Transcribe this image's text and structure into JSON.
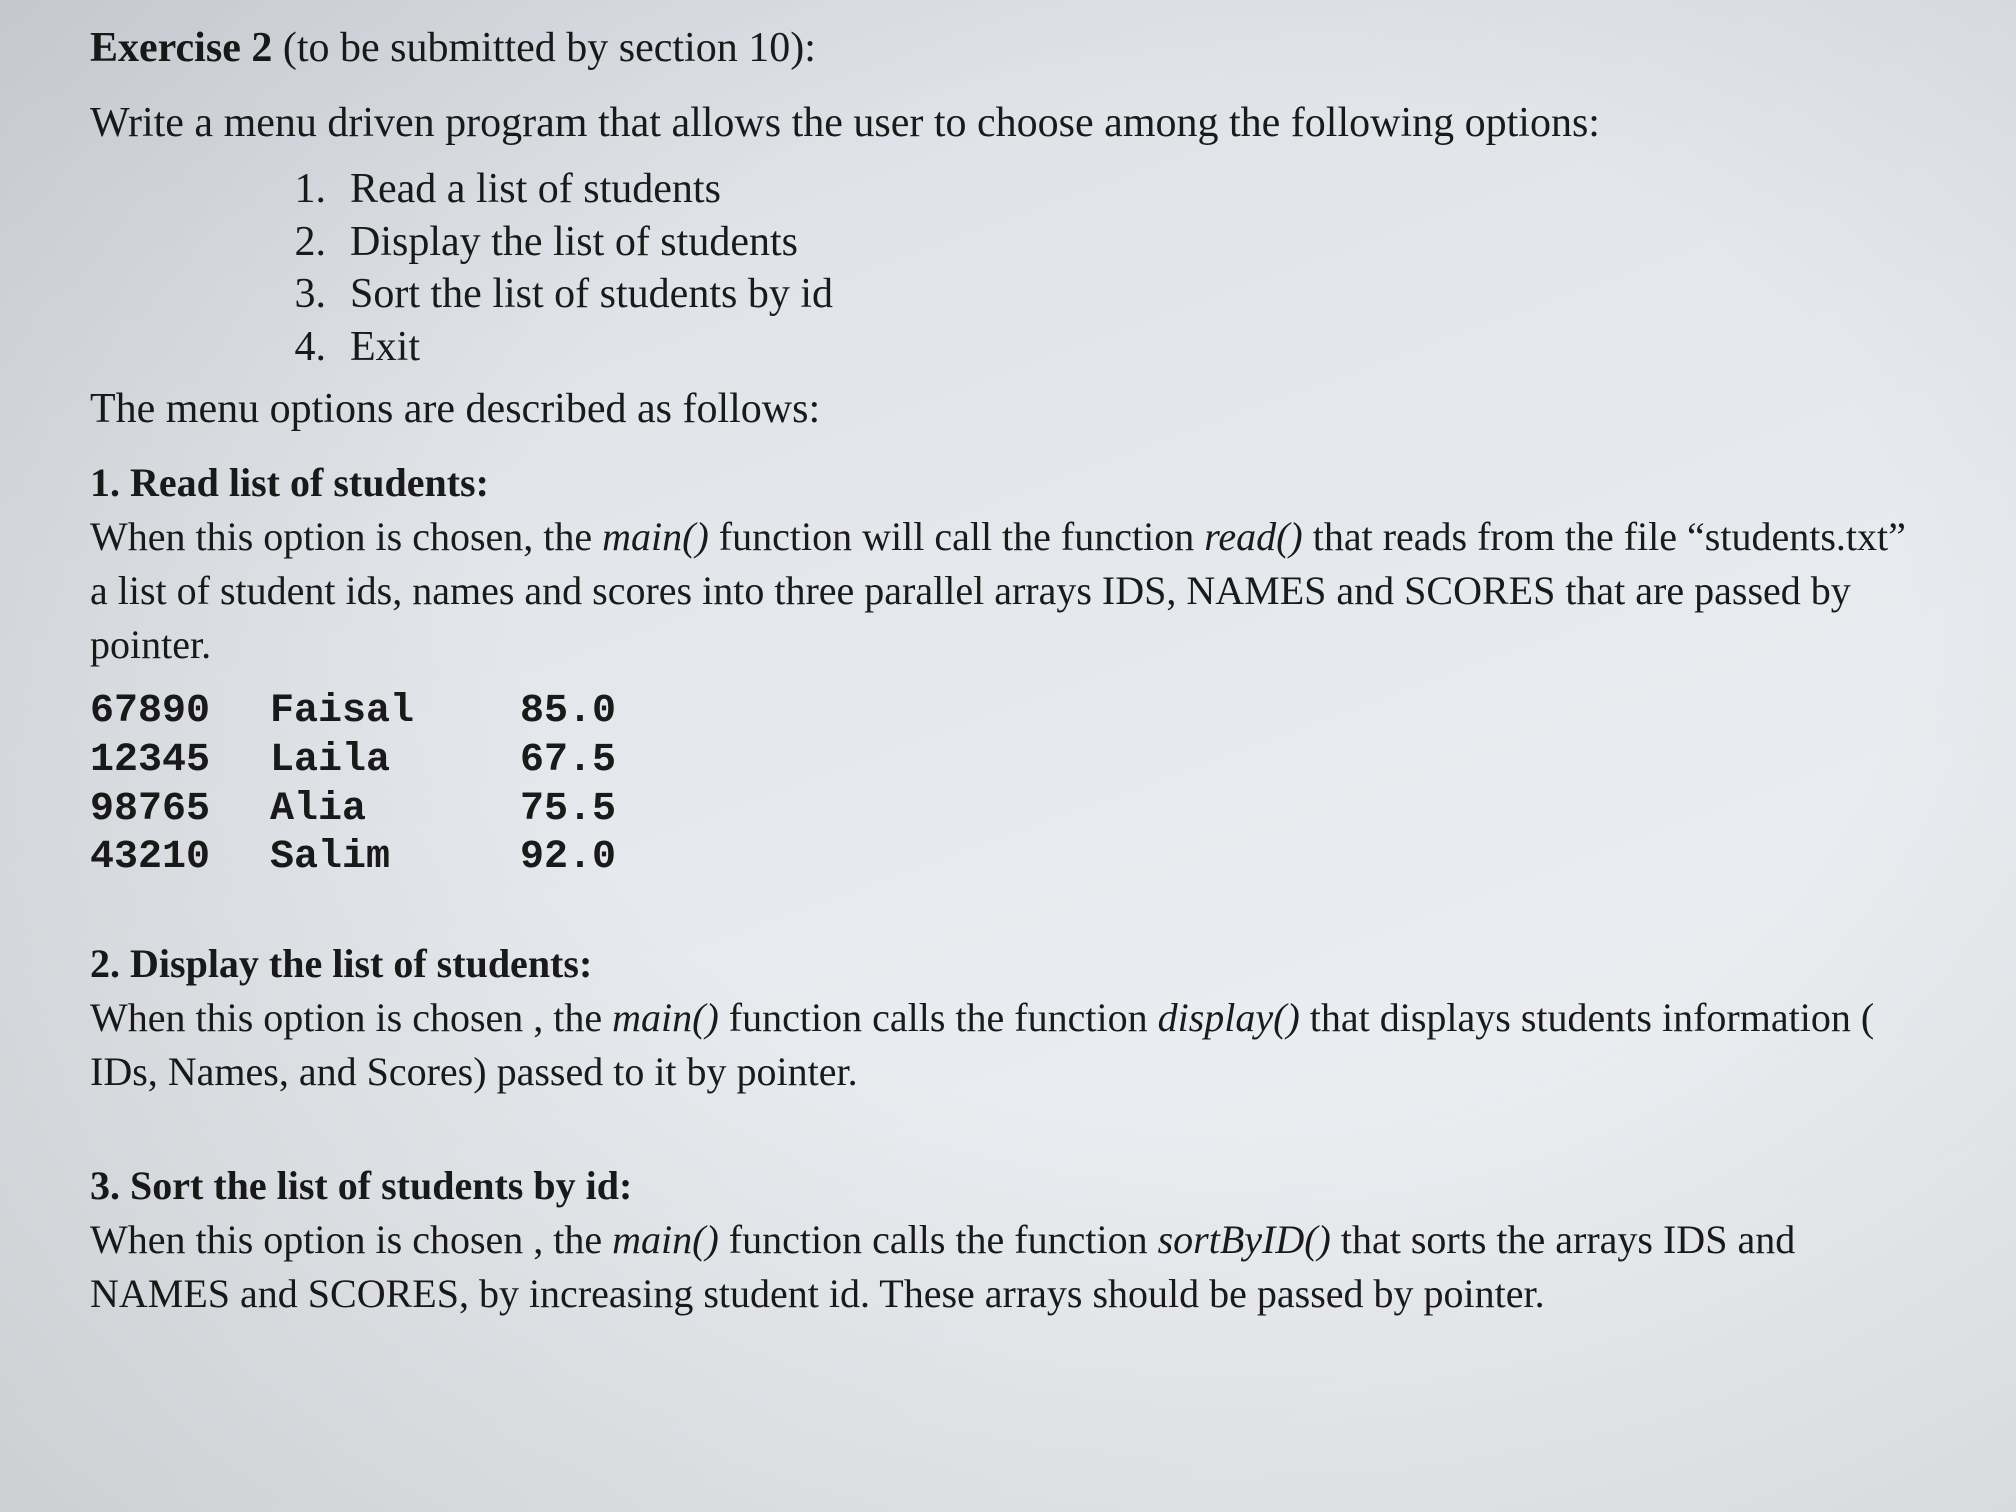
{
  "title": {
    "bold": "Exercise 2",
    "rest": " (to be submitted by section 10):"
  },
  "intro": "Write a  menu driven program that allows the user to choose among the following options:",
  "menu": [
    {
      "num": "1.",
      "label": "Read a list of students"
    },
    {
      "num": "2.",
      "label": "Display the list of students"
    },
    {
      "num": "3.",
      "label": "Sort the list of students by id"
    },
    {
      "num": "4.",
      "label": "Exit"
    }
  ],
  "desc_line": "The menu options are described as follows:",
  "section1": {
    "head": "1. Read list of students:",
    "p1a": "When this option is chosen, the ",
    "p1_main": "main()",
    "p1b": " function will call the function  ",
    "p1_read": "read()",
    "p1c": "  that reads from the file “students.txt” a list of student ids,  names and scores into three parallel arrays IDS, NAMES and SCORES that are passed by pointer."
  },
  "students": [
    {
      "id": "67890",
      "name": "Faisal",
      "score": "85.0"
    },
    {
      "id": "12345",
      "name": "Laila",
      "score": "67.5"
    },
    {
      "id": "98765",
      "name": "Alia",
      "score": "75.5"
    },
    {
      "id": "43210",
      "name": "Salim",
      "score": "92.0"
    }
  ],
  "section2": {
    "head": "2. Display the list of students:",
    "p1a": "When this option is chosen , the ",
    "p1_main": "main()",
    "p1b": " function calls the function  ",
    "p1_disp": "display()",
    "p1c": " that displays students information ( IDs, Names, and Scores) passed to it by pointer."
  },
  "section3": {
    "head": "3. Sort the list of students by id:",
    "p1a": "When this option is chosen , the ",
    "p1_main": "main()",
    "p1b": " function calls the function  ",
    "p1_sort": "sortByID()",
    "p1c": "  that sorts the arrays IDS and NAMES and SCORES, by increasing student id. These arrays should be passed by pointer."
  }
}
